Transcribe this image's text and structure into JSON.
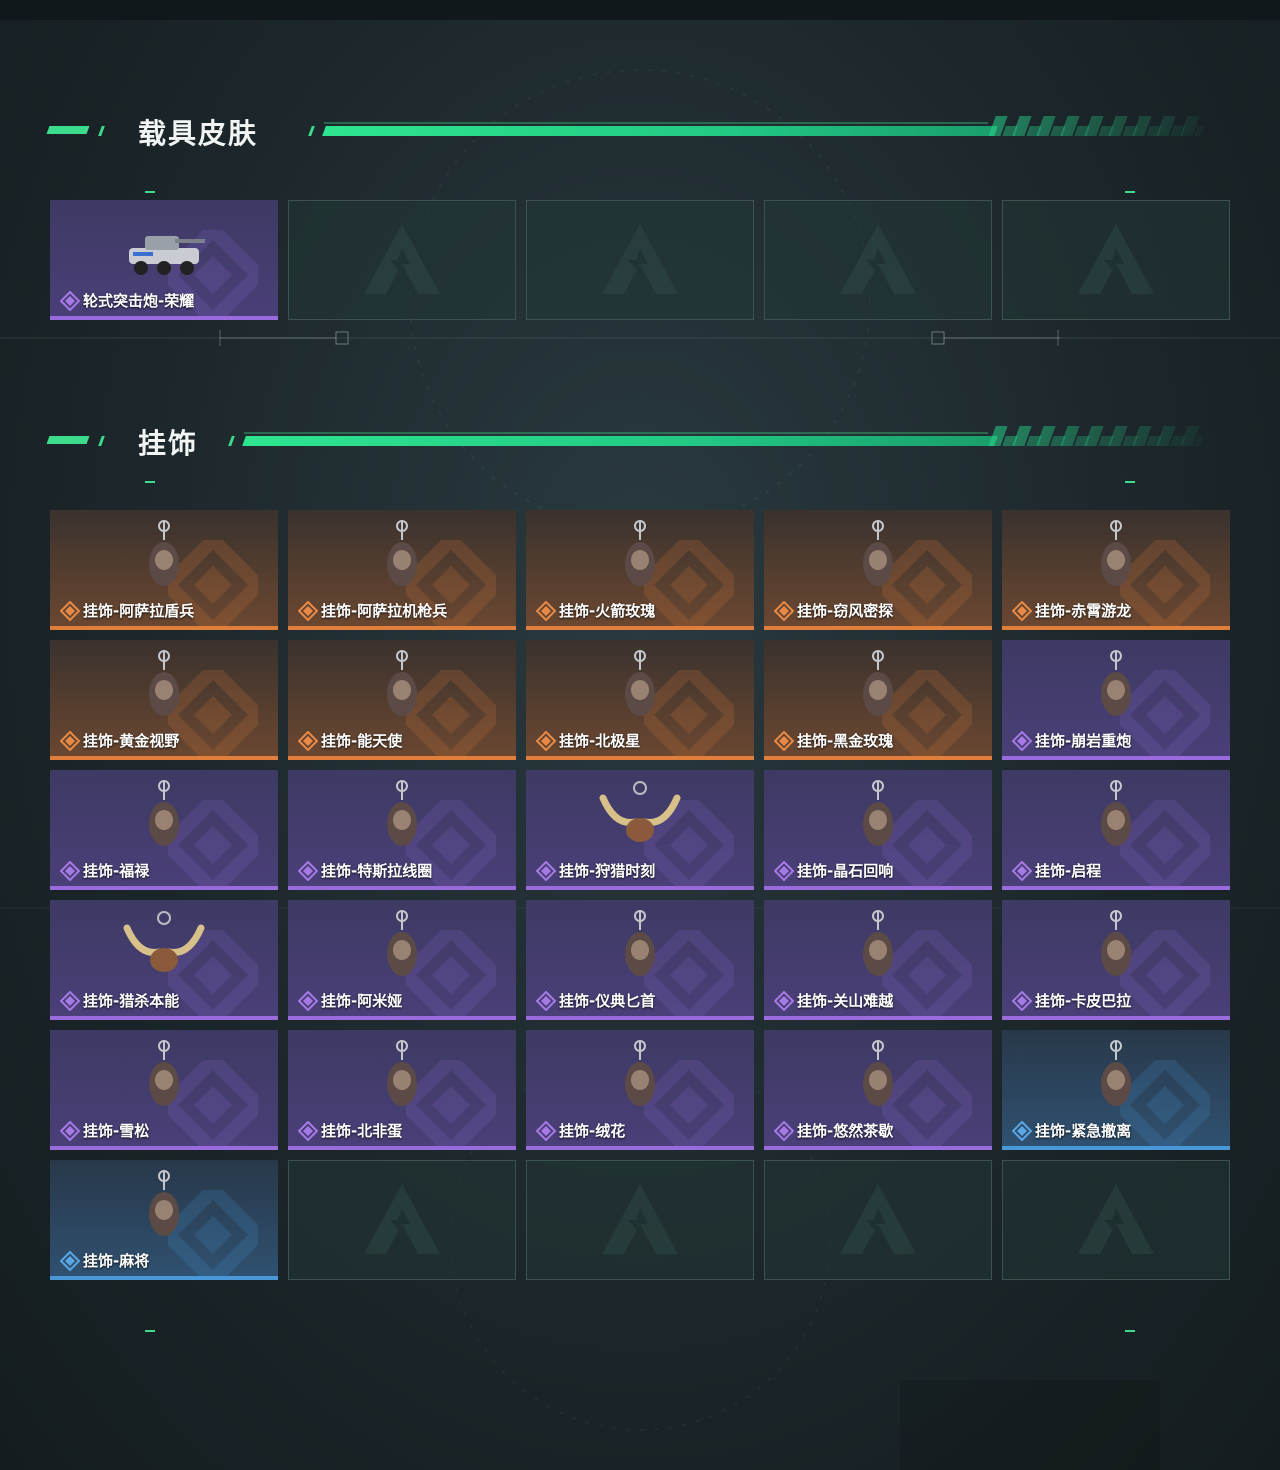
{
  "sections": [
    {
      "title": "载具皮肤",
      "items": [
        {
          "label": "轮式突击炮-荣耀",
          "rarity": "purple",
          "icon": "armored-vehicle-icon"
        },
        {
          "label": "",
          "rarity": "empty",
          "icon": "empty-slot-logo-icon"
        },
        {
          "label": "",
          "rarity": "empty",
          "icon": "empty-slot-logo-icon"
        },
        {
          "label": "",
          "rarity": "empty",
          "icon": "empty-slot-logo-icon"
        },
        {
          "label": "",
          "rarity": "empty",
          "icon": "empty-slot-logo-icon"
        }
      ]
    },
    {
      "title": "挂饰",
      "items": [
        {
          "label": "挂饰-阿萨拉盾兵",
          "rarity": "orange",
          "icon": "shield-soldier-charm-icon"
        },
        {
          "label": "挂饰-阿萨拉机枪兵",
          "rarity": "orange",
          "icon": "gunner-charm-icon"
        },
        {
          "label": "挂饰-火箭玫瑰",
          "rarity": "orange",
          "icon": "rocket-rose-charm-icon"
        },
        {
          "label": "挂饰-窃风密探",
          "rarity": "orange",
          "icon": "wind-agent-charm-icon"
        },
        {
          "label": "挂饰-赤霄游龙",
          "rarity": "orange",
          "icon": "dragon-charm-icon"
        },
        {
          "label": "挂饰-黄金视野",
          "rarity": "orange",
          "icon": "golden-vision-charm-icon"
        },
        {
          "label": "挂饰-能天使",
          "rarity": "orange",
          "icon": "exusiai-charm-icon"
        },
        {
          "label": "挂饰-北极星",
          "rarity": "orange",
          "icon": "polaris-charm-icon"
        },
        {
          "label": "挂饰-黑金玫瑰",
          "rarity": "orange",
          "icon": "black-gold-rose-charm-icon"
        },
        {
          "label": "挂饰-崩岩重炮",
          "rarity": "purple",
          "icon": "rock-cannon-charm-icon"
        },
        {
          "label": "挂饰-福禄",
          "rarity": "purple",
          "icon": "gourd-charm-icon"
        },
        {
          "label": "挂饰-特斯拉线圈",
          "rarity": "purple",
          "icon": "tesla-coil-charm-icon"
        },
        {
          "label": "挂饰-狩猎时刻",
          "rarity": "purple",
          "icon": "antlers-charm-icon"
        },
        {
          "label": "挂饰-晶石回响",
          "rarity": "purple",
          "icon": "crystal-charm-icon"
        },
        {
          "label": "挂饰-启程",
          "rarity": "purple",
          "icon": "medallion-charm-icon"
        },
        {
          "label": "挂饰-猎杀本能",
          "rarity": "purple",
          "icon": "antlers-charm-icon"
        },
        {
          "label": "挂饰-阿米娅",
          "rarity": "purple",
          "icon": "amiya-charm-icon"
        },
        {
          "label": "挂饰-仪典匕首",
          "rarity": "purple",
          "icon": "dagger-charm-icon"
        },
        {
          "label": "挂饰-关山难越",
          "rarity": "purple",
          "icon": "gold-bar-charm-icon"
        },
        {
          "label": "挂饰-卡皮巴拉",
          "rarity": "purple",
          "icon": "capybara-charm-icon"
        },
        {
          "label": "挂饰-雪松",
          "rarity": "purple",
          "icon": "snow-pine-charm-icon"
        },
        {
          "label": "挂饰-北非蛋",
          "rarity": "purple",
          "icon": "shakshuka-charm-icon"
        },
        {
          "label": "挂饰-绒花",
          "rarity": "purple",
          "icon": "velvet-flower-charm-icon"
        },
        {
          "label": "挂饰-悠然茶歇",
          "rarity": "purple",
          "icon": "cupcake-charm-icon"
        },
        {
          "label": "挂饰-紧急撤离",
          "rarity": "blue",
          "icon": "emergency-charm-icon"
        },
        {
          "label": "挂饰-麻将",
          "rarity": "blue",
          "icon": "mahjong-charm-icon"
        },
        {
          "label": "",
          "rarity": "empty",
          "icon": "empty-slot-logo-icon"
        },
        {
          "label": "",
          "rarity": "empty",
          "icon": "empty-slot-logo-icon"
        },
        {
          "label": "",
          "rarity": "empty",
          "icon": "empty-slot-logo-icon"
        },
        {
          "label": "",
          "rarity": "empty",
          "icon": "empty-slot-logo-icon"
        }
      ]
    }
  ],
  "colors": {
    "accent": "#3ddc8c",
    "purple": "#9a6bdc",
    "orange": "#e07e3c",
    "blue": "#4a98d8"
  }
}
